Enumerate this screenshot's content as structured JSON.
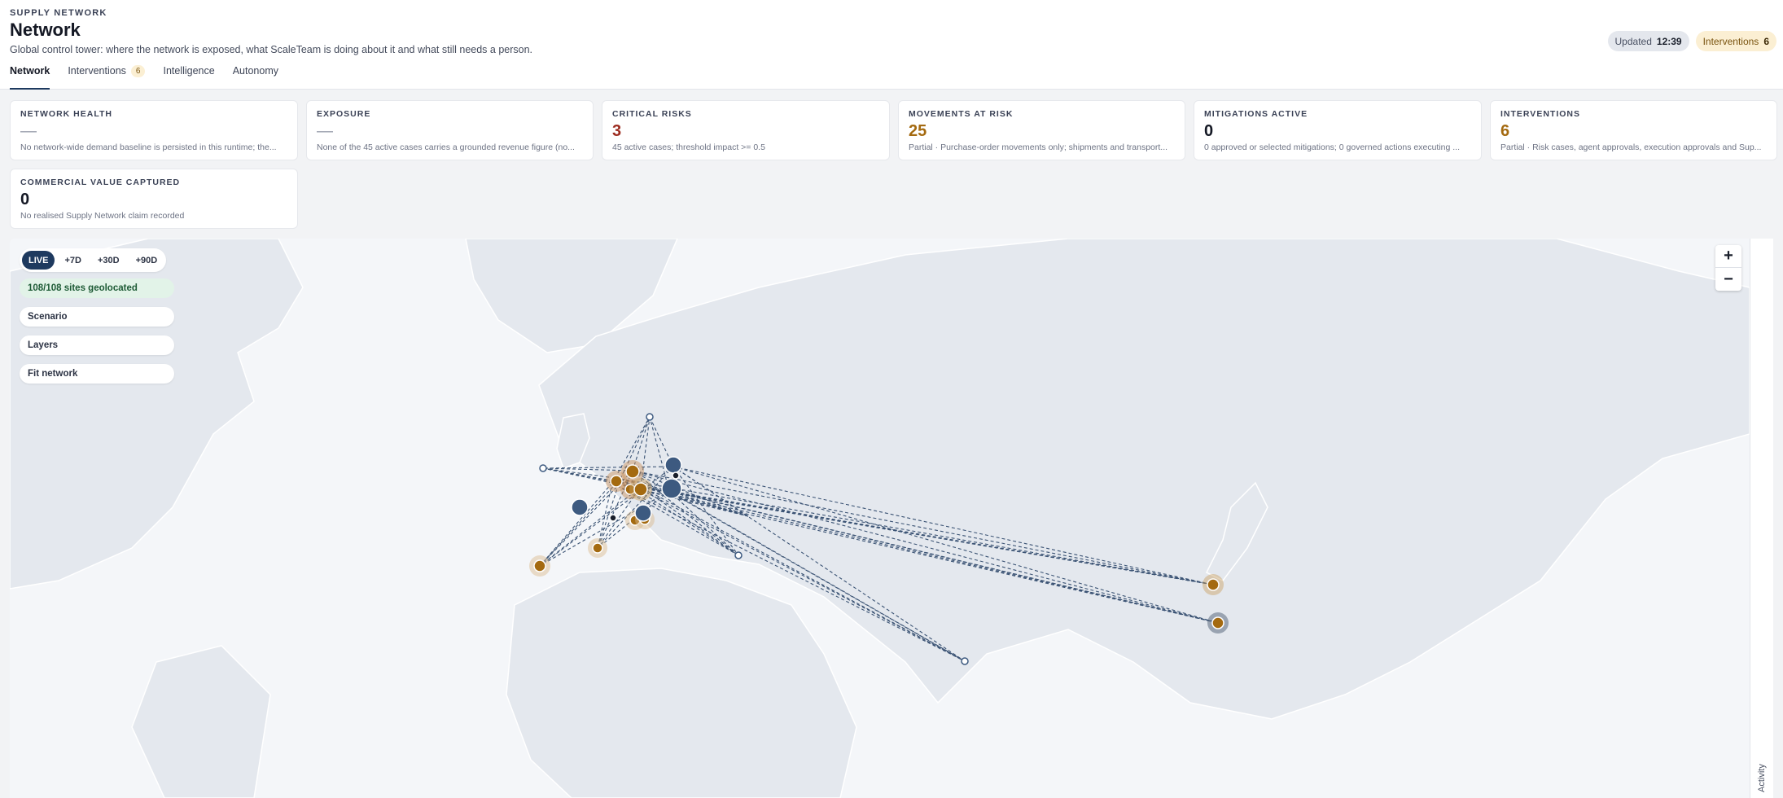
{
  "header": {
    "eyebrow": "SUPPLY NETWORK",
    "title": "Network",
    "subtitle": "Global control tower: where the network is exposed, what ScaleTeam is doing about it and what still needs a person.",
    "updated_label": "Updated",
    "updated_time": "12:39",
    "interventions_label": "Interventions",
    "interventions_count": "6"
  },
  "tabs": [
    {
      "label": "Network",
      "active": true
    },
    {
      "label": "Interventions",
      "badge": "6"
    },
    {
      "label": "Intelligence"
    },
    {
      "label": "Autonomy"
    }
  ],
  "kpis": [
    {
      "label": "NETWORK HEALTH",
      "value": "—",
      "note": "No network-wide demand baseline is persisted in this runtime; the..."
    },
    {
      "label": "EXPOSURE",
      "value": "—",
      "note": "None of the 45 active cases carries a grounded revenue figure (no..."
    },
    {
      "label": "CRITICAL RISKS",
      "value": "3",
      "note": "45 active cases; threshold impact >= 0.5"
    },
    {
      "label": "MOVEMENTS AT RISK",
      "value": "25",
      "note": "Partial · Purchase-order movements only; shipments and transport..."
    },
    {
      "label": "MITIGATIONS ACTIVE",
      "value": "0",
      "note": "0 approved or selected mitigations; 0 governed actions executing ..."
    },
    {
      "label": "INTERVENTIONS",
      "value": "6",
      "note": "Partial · Risk cases, agent approvals, execution approvals and Sup..."
    },
    {
      "label": "COMMERCIAL VALUE CAPTURED",
      "value": "0",
      "note": "No realised Supply Network claim recorded"
    }
  ],
  "map": {
    "horizons": [
      "LIVE",
      "+7D",
      "+30D",
      "+90D"
    ],
    "active_horizon": "LIVE",
    "geolocated": "108/108 sites geolocated",
    "buttons": [
      "Scenario",
      "Layers",
      "Fit network"
    ],
    "zoom_in": "+",
    "zoom_out": "−",
    "activity_label": "Activity"
  },
  "colors": {
    "accent": "#1e3a5f",
    "risk_amber": "#a46a10",
    "critical_red": "#9c2b1f",
    "node_blue": "#3d5a80",
    "healthy_green": "#1e5b36"
  }
}
